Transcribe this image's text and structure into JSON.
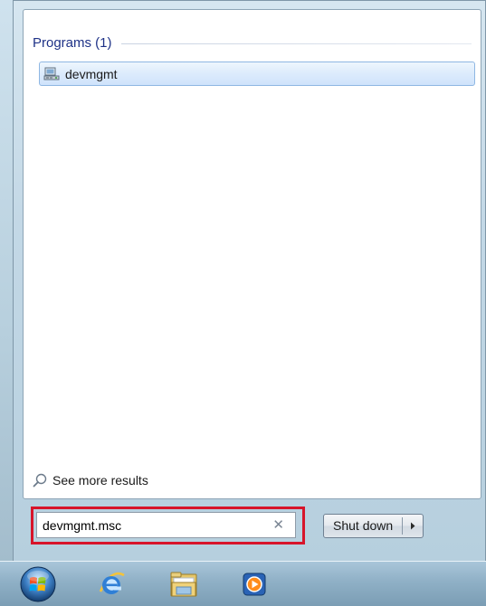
{
  "start_menu": {
    "group": {
      "title": "Programs (1)",
      "items": [
        {
          "label": "devmgmt",
          "icon": "device-manager-icon"
        }
      ]
    },
    "see_more_label": "See more results",
    "search": {
      "value": "devmgmt.msc",
      "clear_icon": "close-icon"
    },
    "shutdown": {
      "label": "Shut down",
      "arrow_icon": "chevron-right-icon"
    }
  },
  "taskbar": {
    "start_icon": "windows-start-orb-icon",
    "pinned": [
      {
        "name": "internet-explorer-icon"
      },
      {
        "name": "windows-explorer-icon"
      },
      {
        "name": "media-player-icon"
      }
    ]
  },
  "colors": {
    "group_title": "#1e3287",
    "highlight_border": "#d7142a",
    "selected_item_bg": "#dcebfc"
  }
}
